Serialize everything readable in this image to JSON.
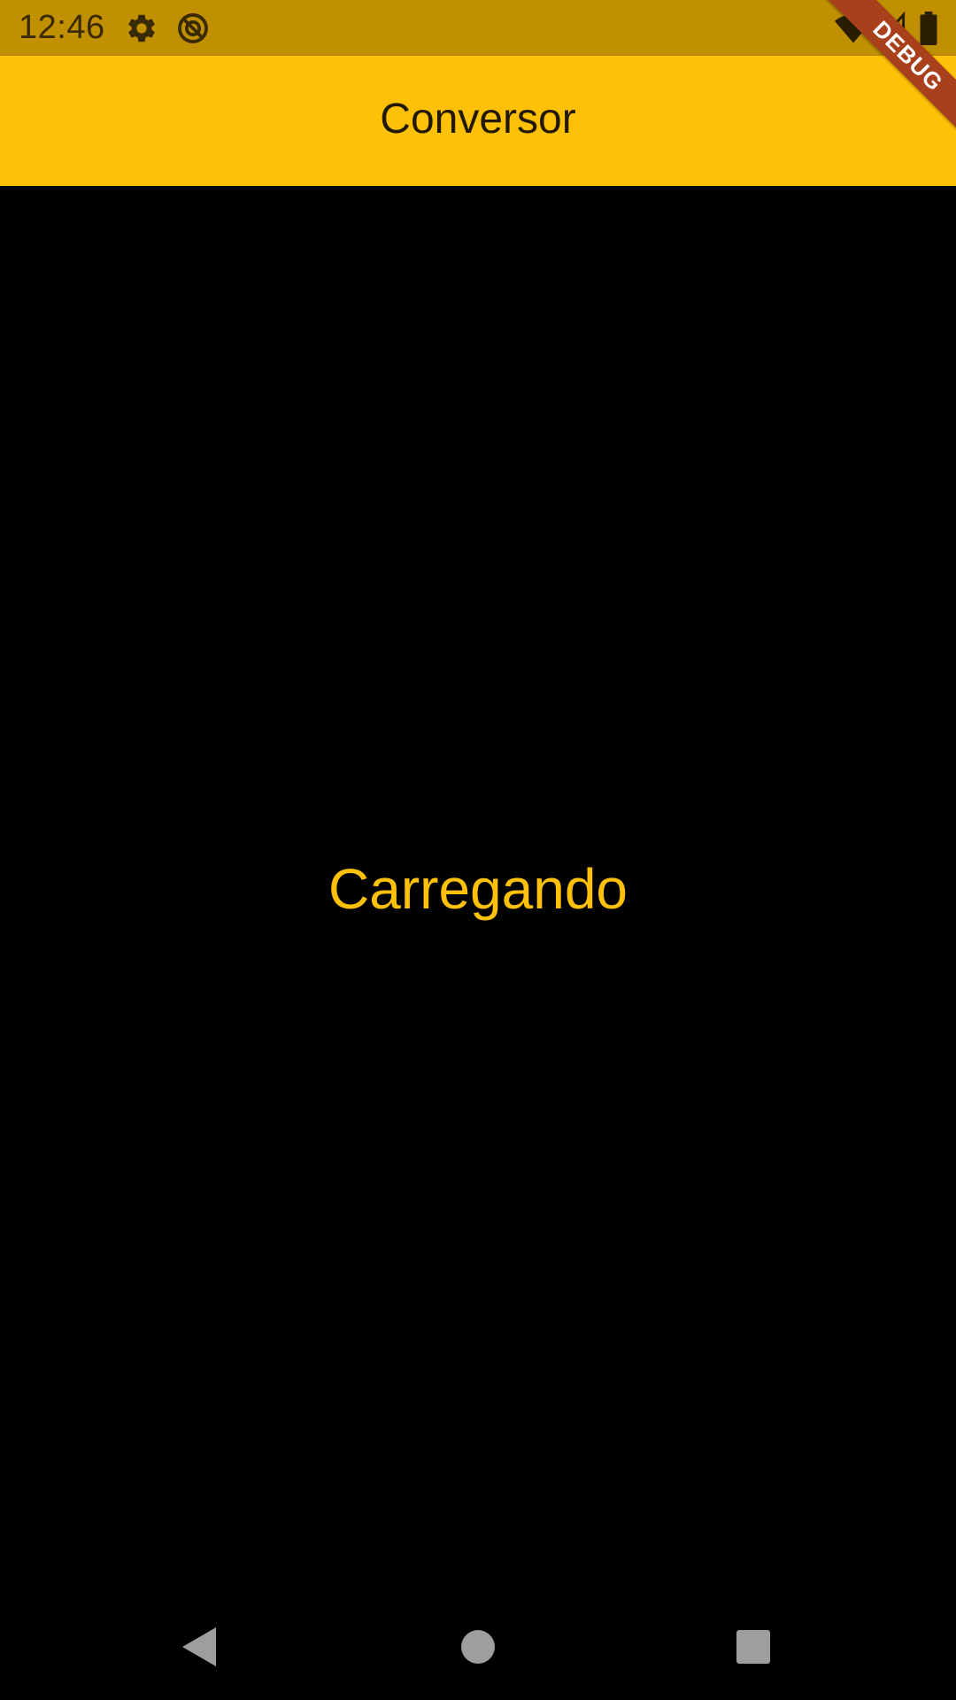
{
  "status_bar": {
    "time": "12:46",
    "icons": [
      "gear-icon",
      "sync-disabled-icon",
      "wifi-icon",
      "signal-icon",
      "battery-icon"
    ]
  },
  "app_bar": {
    "title": "Conversor"
  },
  "content": {
    "loading_text": "Carregando"
  },
  "debug_banner": {
    "label": "DEBUG"
  },
  "nav_bar": {
    "buttons": [
      "back-icon",
      "home-icon",
      "recents-icon"
    ]
  },
  "colors": {
    "status_bar": "#c09000",
    "app_bar": "#ffc107",
    "background": "#000000",
    "accent_text": "#ffc107",
    "debug_ribbon": "#a8401c"
  }
}
